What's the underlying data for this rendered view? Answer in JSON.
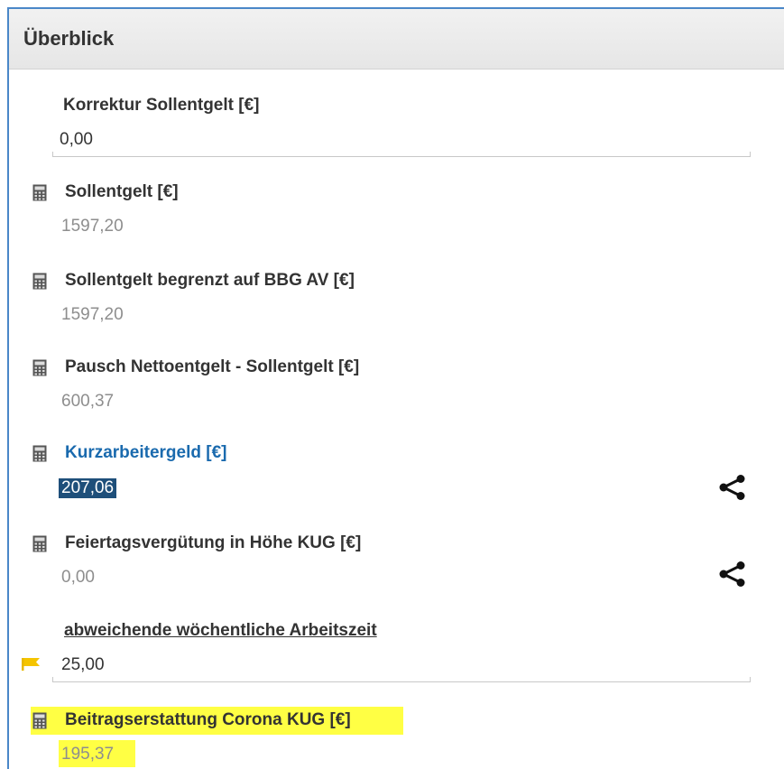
{
  "panel": {
    "title": "Überblick"
  },
  "fields": {
    "korrektur": {
      "label": "Korrektur Sollentgelt [€]",
      "value": "0,00"
    },
    "sollentgelt": {
      "label": "Sollentgelt [€]",
      "value": "1597,20"
    },
    "sollentgelt_bbg": {
      "label": "Sollentgelt begrenzt auf BBG AV [€]",
      "value": "1597,20"
    },
    "pausch": {
      "label": "Pausch Nettoentgelt - Sollentgelt [€]",
      "value": "600,37"
    },
    "kurzarbeitergeld": {
      "label": "Kurzarbeitergeld [€]",
      "value": "207,06"
    },
    "feiertag": {
      "label": "Feiertagsvergütung in Höhe KUG [€]",
      "value": "0,00"
    },
    "arbeitszeit": {
      "label": "abweichende wöchentliche Arbeitszeit",
      "value": "25,00"
    },
    "beitragserstattung": {
      "label": "Beitragserstattung Corona KUG [€]",
      "value": "195,37"
    }
  },
  "icons": {
    "calculator": "calculator-icon",
    "share": "share-icon",
    "flag": "flag-icon"
  },
  "colors": {
    "panel_border": "#4a87c8",
    "link_blue": "#1a6aae",
    "selection": "#1e4f7a",
    "highlight": "#ffff44",
    "flag": "#f5c400"
  }
}
